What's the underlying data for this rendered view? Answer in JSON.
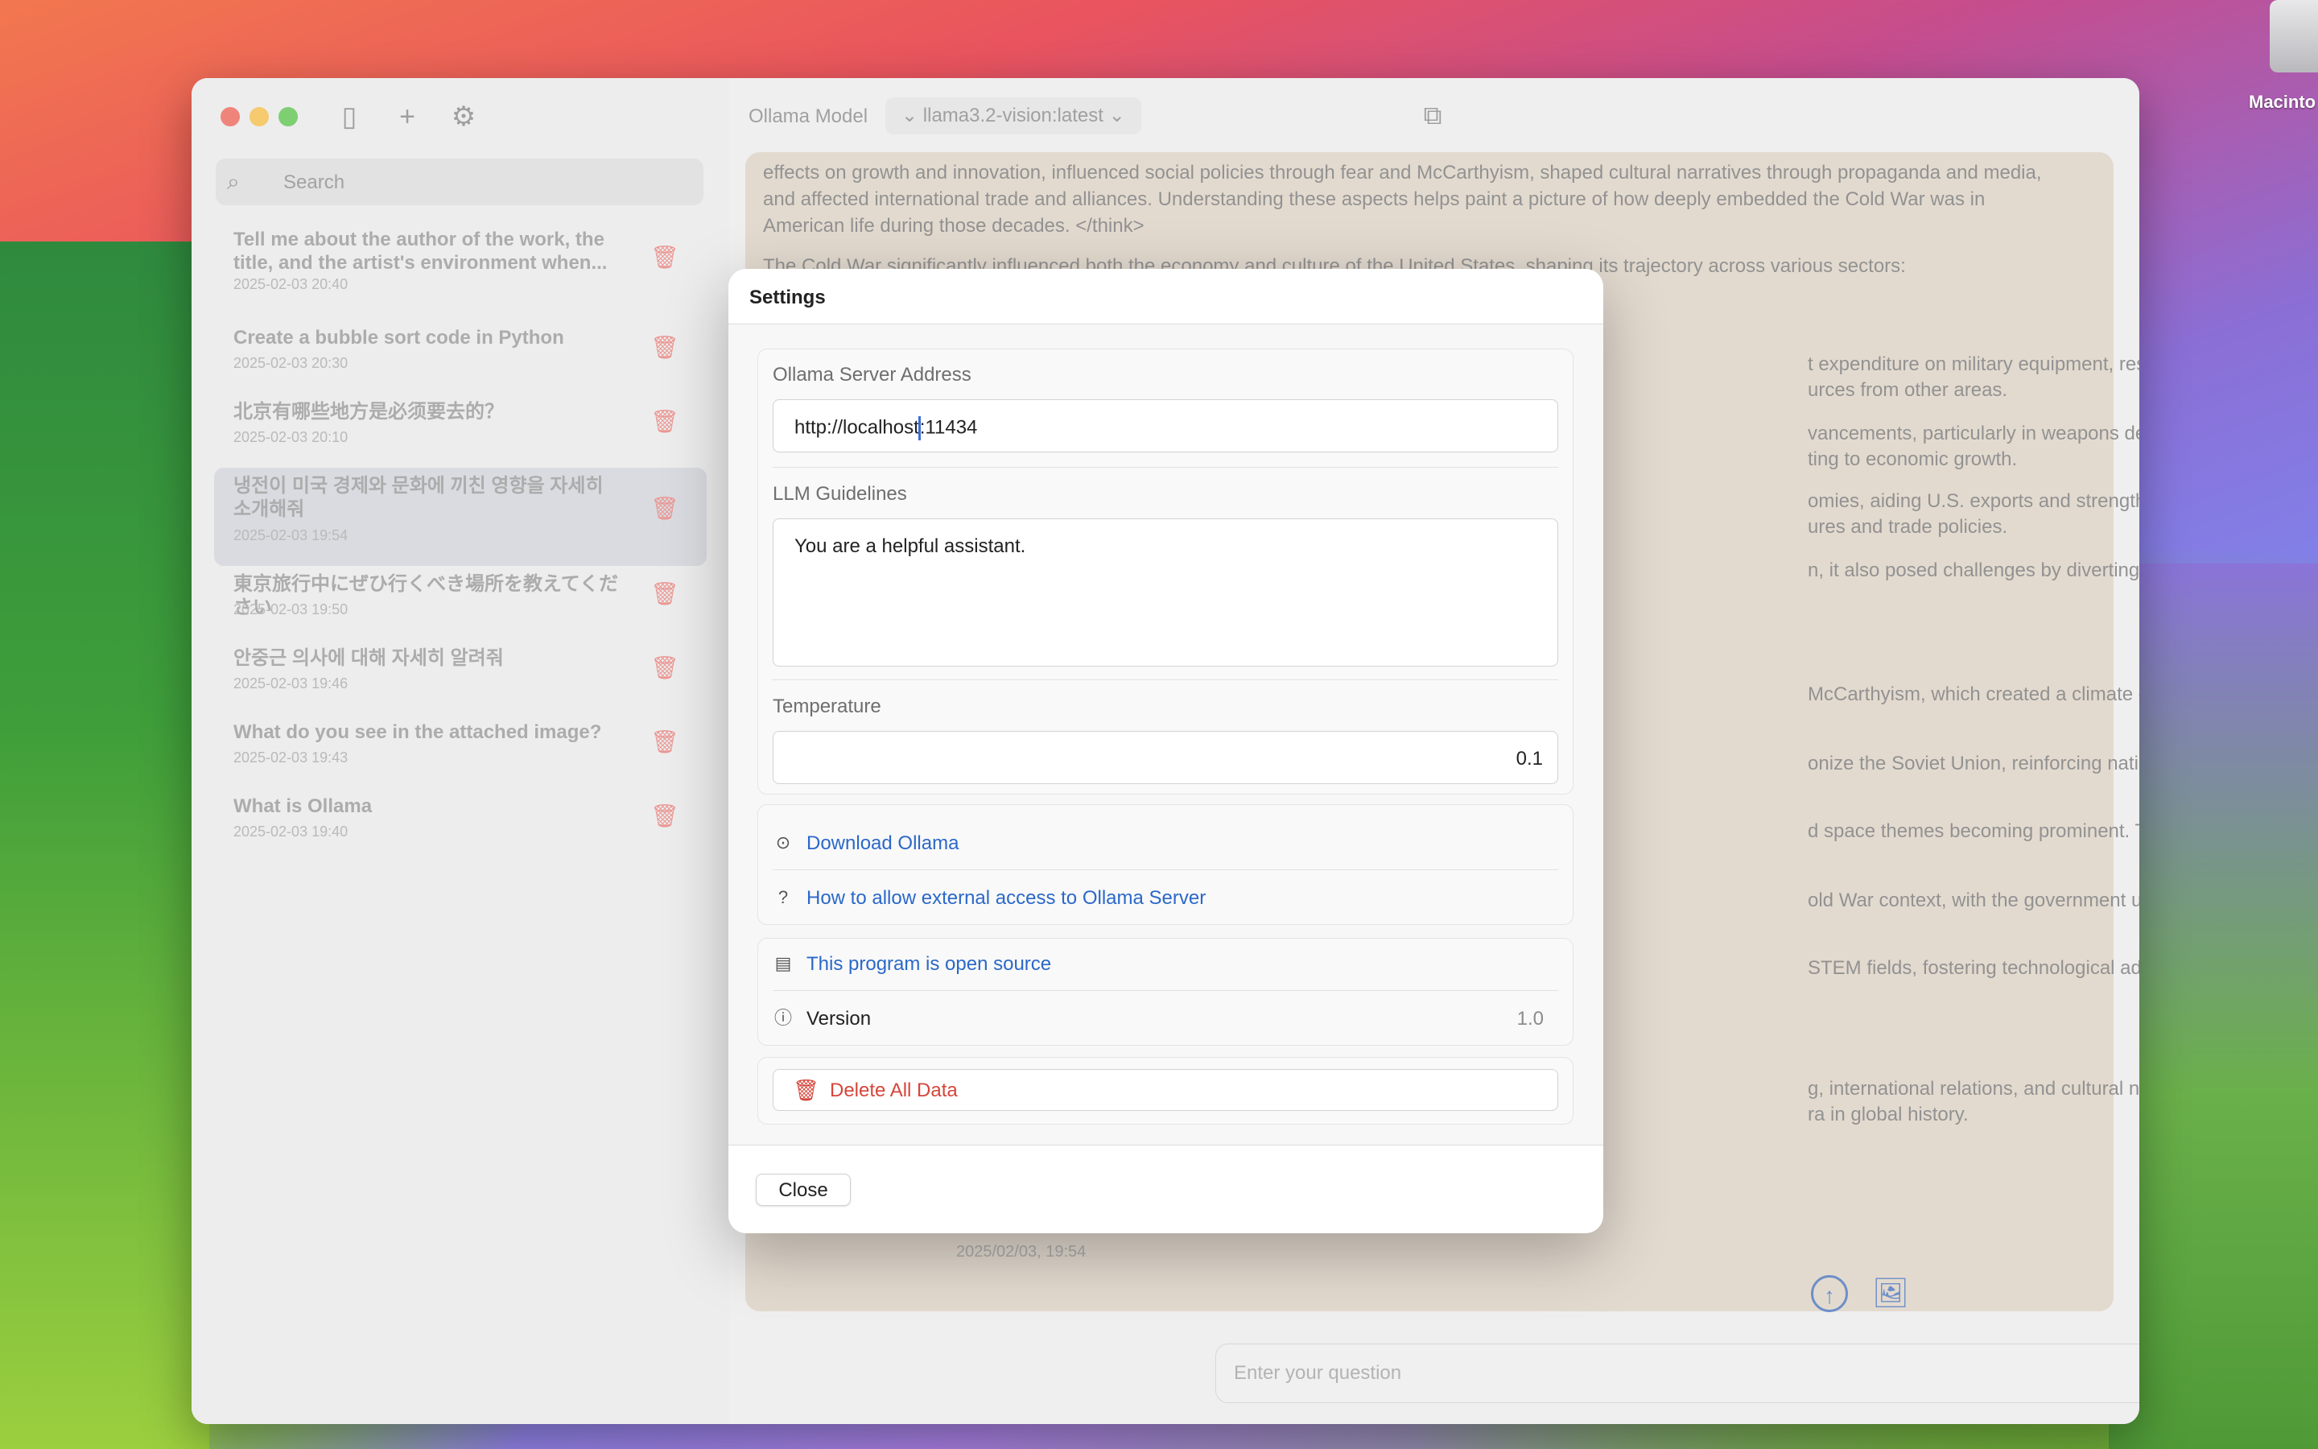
{
  "desktop": {
    "disk_label": "Macinto"
  },
  "sidebar": {
    "search_placeholder": "Search",
    "conversations": [
      {
        "title": "Tell me about the author of the work, the title, and the artist's environment when...",
        "date": "2025-02-03 20:40"
      },
      {
        "title": "Create a bubble sort code in Python",
        "date": "2025-02-03 20:30"
      },
      {
        "title": "北京有哪些地方是必须要去的？",
        "date": "2025-02-03 20:10"
      },
      {
        "title": "냉전이 미국 경제와 문화에 끼친 영향을 자세히 소개해줘",
        "date": "2025-02-03 19:54"
      },
      {
        "title": "東京旅行中にぜひ行くべき場所を教えてください",
        "date": "2025-02-03 19:50"
      },
      {
        "title": "안중근 의사에 대해 자세히 알려줘",
        "date": "2025-02-03 19:46"
      },
      {
        "title": "What do you see in the attached image?",
        "date": "2025-02-03 19:43"
      },
      {
        "title": "What is Ollama",
        "date": "2025-02-03 19:40"
      }
    ]
  },
  "toolbar": {
    "model_label": "Ollama Model",
    "model_value": "llama3.2-vision:latest"
  },
  "chat": {
    "lines_full": [
      "effects on growth and innovation, influenced social policies through fear and McCarthyism, shaped cultural narratives through propaganda and media,",
      "and affected international trade and alliances. Understanding these aspects helps paint a picture of how deeply embedded the Cold War was in",
      "American life during those decades. </think>",
      "The Cold War significantly influenced both the economy and culture of the United States, shaping its trajectory across various sectors:"
    ],
    "lines_right": [
      "t expenditure on military equipment, research, and",
      "urces from other areas.",
      "vancements, particularly in weapons development and",
      "ting to economic growth.",
      "omies, aiding U.S. exports and strengthening",
      "ures and trade policies.",
      "n, it also posed challenges by diverting resources from",
      "McCarthyism, which created a climate of fear and",
      "onize the Soviet Union, reinforcing national identity but",
      "d space themes becoming prominent. This period saw",
      "old War context, with the government using it to justify",
      "STEM fields, fostering technological advancements",
      "g, international relations, and cultural narratives. It",
      "ra in global history."
    ],
    "timestamp": "2025/02/03, 19:54",
    "input_placeholder": "Enter your question"
  },
  "settings": {
    "title": "Settings",
    "server_label": "Ollama Server Address",
    "server_value_before_caret": "http://localhost",
    "server_value_after_caret": ":11434",
    "guidelines_label": "LLM Guidelines",
    "guidelines_value": "You are a helpful assistant.",
    "temperature_label": "Temperature",
    "temperature_value": "0.1",
    "download_link": "Download Ollama",
    "external_access_link": "How to allow external access to Ollama Server",
    "open_source_link": "This program is open source",
    "version_label": "Version",
    "version_value": "1.0",
    "delete_label": "Delete All Data",
    "close_label": "Close"
  }
}
